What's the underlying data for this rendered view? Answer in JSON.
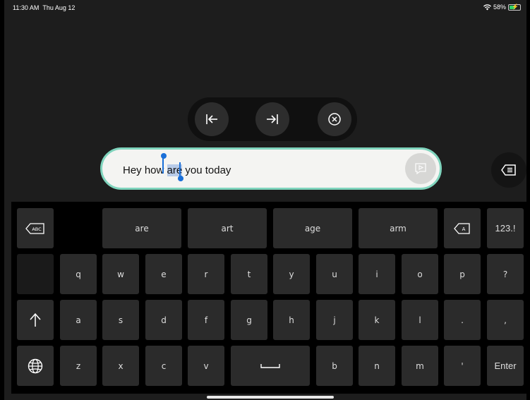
{
  "status_bar": {
    "time": "11:30 AM",
    "date": "Thu Aug 12",
    "battery_percent": "58%",
    "battery_level": 0.58,
    "wifi_icon": "wifi-icon"
  },
  "caret_nav": {
    "left_icon": "caret-to-start-icon",
    "right_icon": "caret-to-end-icon",
    "clear_icon": "clear-circle-icon"
  },
  "input": {
    "text_before": "Hey how ",
    "selected_text": "are",
    "text_after": " you today",
    "speak_icon": "speak-play-icon"
  },
  "side_button_icon": "text-lines-icon",
  "suggestions": [
    "are",
    "art",
    "age",
    "arm"
  ],
  "keyboard": {
    "row1_letters": [
      "q",
      "w",
      "e",
      "r",
      "t",
      "y",
      "u",
      "i",
      "o",
      "p",
      "?"
    ],
    "row2_letters": [
      "a",
      "s",
      "d",
      "f",
      "g",
      "h",
      "j",
      "k",
      "l",
      ".",
      ","
    ],
    "row3_letters": [
      "z",
      "x",
      "c",
      "v"
    ],
    "row3_after_space": [
      "b",
      "n",
      "m",
      "'"
    ],
    "numbers_label": "123.!",
    "enter_label": "Enter",
    "abc_label": "ABC",
    "a_label": "A"
  },
  "colors": {
    "accent": "#7fd4bd",
    "selection": "#1a6fd8",
    "key": "#2b2b2b",
    "background": "#1d1d1d"
  }
}
